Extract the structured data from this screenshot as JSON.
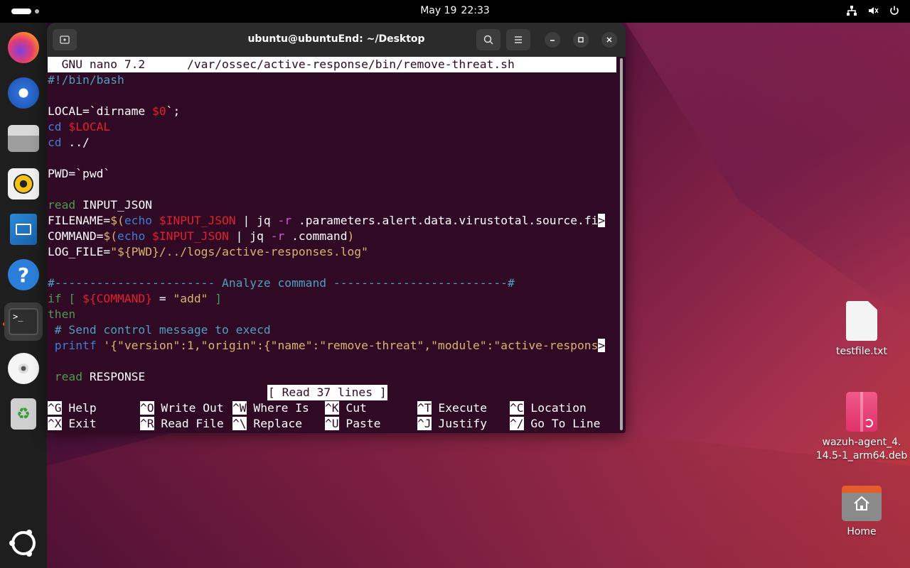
{
  "topbar": {
    "date": "May 19",
    "time": "22:33",
    "tray_icons": [
      "network-icon",
      "volume-muted-icon",
      "power-icon"
    ]
  },
  "dock": {
    "items": [
      {
        "name": "firefox",
        "icon": "firefox-icon"
      },
      {
        "name": "thunderbird",
        "icon": "thunderbird-icon"
      },
      {
        "name": "files",
        "icon": "files-icon"
      },
      {
        "name": "rhythmbox",
        "icon": "rhythmbox-icon"
      },
      {
        "name": "writer",
        "icon": "writer-icon"
      },
      {
        "name": "help",
        "icon": "help-icon"
      },
      {
        "name": "terminal",
        "icon": "terminal-icon",
        "active": true
      },
      {
        "name": "disc",
        "icon": "disc-icon"
      },
      {
        "name": "trash",
        "icon": "trash-icon"
      },
      {
        "name": "apps",
        "icon": "ubuntu-apps-icon"
      }
    ]
  },
  "window": {
    "title": "ubuntu@ubuntuEnd: ~/Desktop"
  },
  "nano": {
    "header": "  GNU nano 7.2      /var/ossec/active-response/bin/remove-threat.sh",
    "status": "[ Read 37 lines ]",
    "shortcuts_row1": [
      {
        "key": "^G",
        "label": "Help"
      },
      {
        "key": "^O",
        "label": "Write Out"
      },
      {
        "key": "^W",
        "label": "Where Is"
      },
      {
        "key": "^K",
        "label": "Cut"
      },
      {
        "key": "^T",
        "label": "Execute"
      },
      {
        "key": "^C",
        "label": "Location"
      }
    ],
    "shortcuts_row2": [
      {
        "key": "^X",
        "label": "Exit"
      },
      {
        "key": "^R",
        "label": "Read File"
      },
      {
        "key": "^\\",
        "label": "Replace"
      },
      {
        "key": "^U",
        "label": "Paste"
      },
      {
        "key": "^J",
        "label": "Justify"
      },
      {
        "key": "^/",
        "label": "Go To Line"
      }
    ],
    "code": {
      "l1": "#!/bin/bash",
      "l3a": "LOCAL=`dirname ",
      "l3b": "$0",
      "l3c": "`;",
      "l4a": "cd ",
      "l4b": "$LOCAL",
      "l5a": "cd",
      "l5b": " ../",
      "l7": "PWD=`pwd`",
      "l9a": "read",
      "l9b": " INPUT_JSON",
      "l10a": "FILENAME=",
      "l10b": "$(",
      "l10c": "echo ",
      "l10d": "$INPUT_JSON",
      "l10e": " | jq ",
      "l10f": "-r",
      "l10g": " .parameters.alert.data.virustotal.source.fi",
      "l11a": "COMMAND=",
      "l11b": "$(",
      "l11c": "echo ",
      "l11d": "$INPUT_JSON",
      "l11e": " | jq ",
      "l11f": "-r",
      "l11g": " .command",
      "l11h": ")",
      "l12a": "LOG_FILE=",
      "l12b": "\"${PWD}/../logs/active-responses.log\"",
      "l14": "#----------------------- Analyze command -------------------------#",
      "l15a": "if [ ",
      "l15b": "${COMMAND}",
      "l15c": " = ",
      "l15d": "\"add\"",
      "l15e": " ]",
      "l16": "then",
      "l17": " # Send control message to execd",
      "l18a": " printf",
      "l18b": " '{\"version\":1,\"origin\":{\"name\":\"remove-threat\",\"module\":\"active-respons",
      "l20a": " read",
      "l20b": " RESPONSE",
      "overflow": ">"
    }
  },
  "desktop": {
    "icons": [
      {
        "label": "testfile.txt",
        "icon": "text-file-icon"
      },
      {
        "label": "wazuh-agent_4.\n14.5-1_arm64.deb",
        "icon": "deb-package-icon"
      },
      {
        "label": "Home",
        "icon": "home-folder-icon"
      }
    ]
  }
}
